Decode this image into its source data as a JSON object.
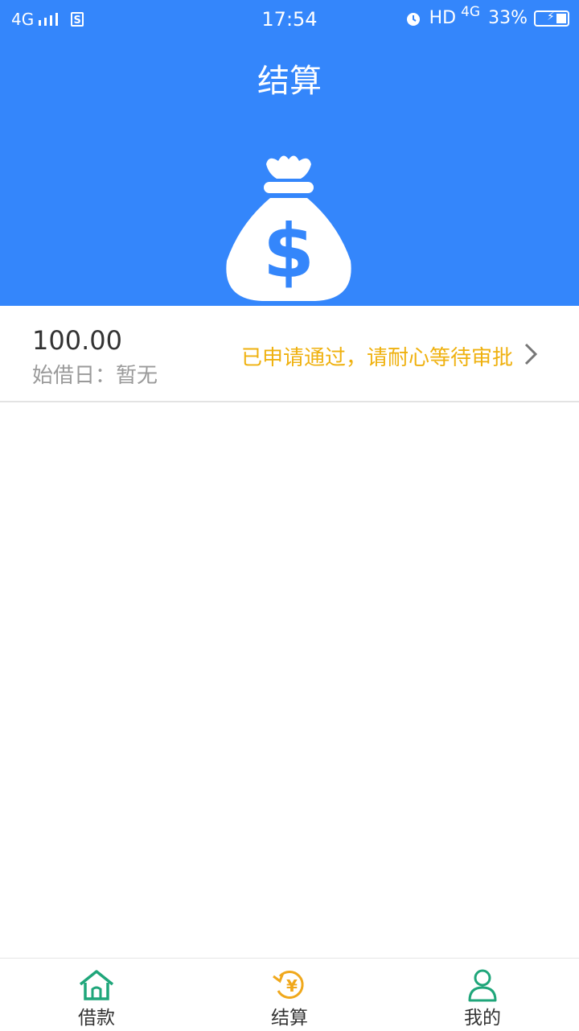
{
  "status_bar": {
    "network": "4G",
    "time": "17:54",
    "hd": "HD",
    "network_right": "4G",
    "battery": "33%"
  },
  "header": {
    "title": "结算",
    "icon": "money-bag-icon"
  },
  "loan": {
    "amount": "100.00",
    "start_date_label": "始借日：",
    "start_date_value": "暂无",
    "status_text": "已申请通过，请耐心等待审批"
  },
  "tabbar": {
    "tabs": [
      {
        "label": "借款",
        "icon": "home-icon"
      },
      {
        "label": "结算",
        "icon": "yuan-settle-icon"
      },
      {
        "label": "我的",
        "icon": "person-icon"
      }
    ]
  },
  "colors": {
    "header_bg": "#3486fb",
    "status_text": "#efb10f",
    "tab_green": "#1fa67a",
    "tab_orange": "#f0a81c"
  }
}
